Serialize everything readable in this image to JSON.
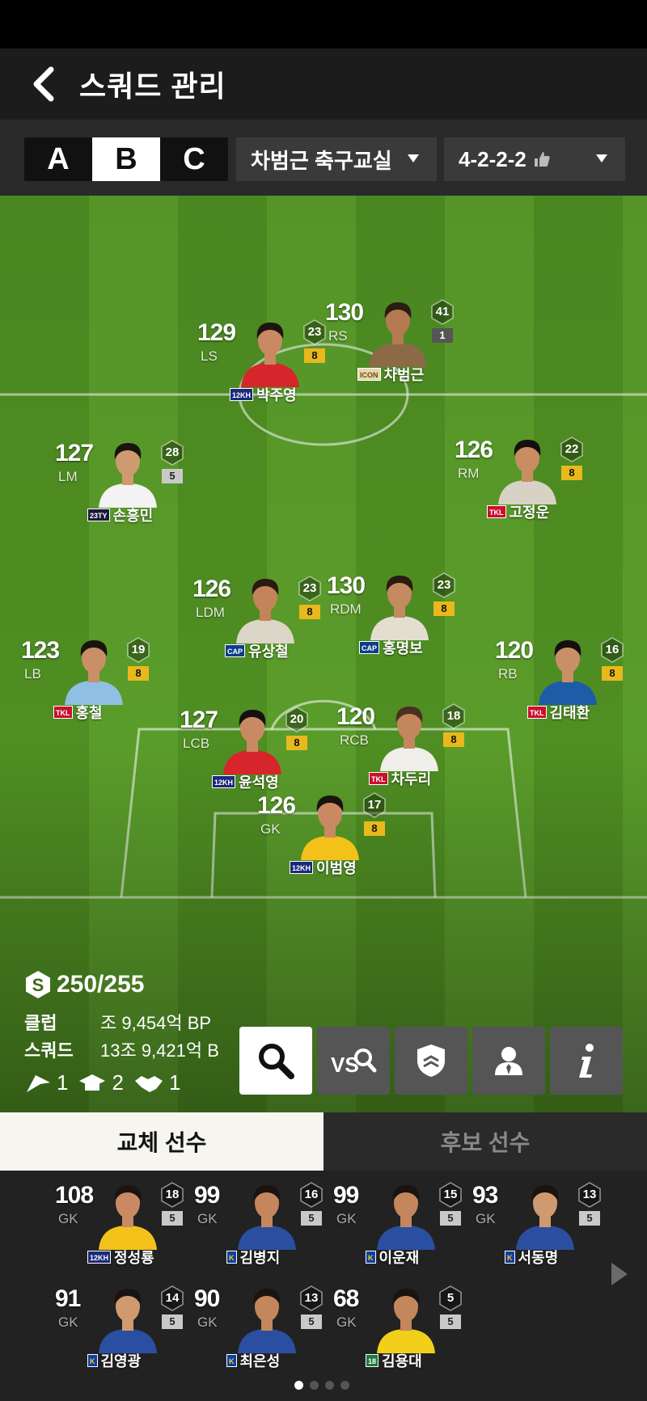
{
  "header": {
    "title": "스쿼드 관리"
  },
  "squad_tabs": [
    "A",
    "B",
    "C"
  ],
  "team_dropdown": {
    "value": "차범근 축구교실"
  },
  "formation_dropdown": {
    "value": "4-2-2-2"
  },
  "starters": [
    {
      "ovr": "129",
      "pos": "LS",
      "name": "박주영",
      "badge": "12KH",
      "badge_class": "b-12kh",
      "chem": "23",
      "level": "8",
      "level_style": "gold",
      "shirt": "#d7262b",
      "skin": "#c98a63",
      "hair": "#1c140f"
    },
    {
      "ovr": "130",
      "pos": "RS",
      "name": "차범근",
      "badge": "ICON",
      "badge_class": "b-icon",
      "chem": "41",
      "level": "1",
      "level_style": "gray",
      "shirt": "#8c6a45",
      "skin": "#b37a52",
      "hair": "#2a1c12"
    },
    {
      "ovr": "127",
      "pos": "LM",
      "name": "손흥민",
      "badge": "23TY",
      "badge_class": "b-23ty",
      "chem": "28",
      "level": "5",
      "level_style": "silver",
      "shirt": "#f3f3f3",
      "skin": "#d09a70",
      "hair": "#1a1410"
    },
    {
      "ovr": "126",
      "pos": "RM",
      "name": "고정운",
      "badge": "TKL",
      "badge_class": "b-tkl",
      "chem": "22",
      "level": "8",
      "level_style": "gold",
      "shirt": "#d8d2c4",
      "skin": "#c88d63",
      "hair": "#141010"
    },
    {
      "ovr": "126",
      "pos": "LDM",
      "name": "유상철",
      "badge": "CAP",
      "badge_class": "b-cap",
      "chem": "23",
      "level": "8",
      "level_style": "gold",
      "shirt": "#dcd6c8",
      "skin": "#c28458",
      "hair": "#2a1b10"
    },
    {
      "ovr": "130",
      "pos": "RDM",
      "name": "홍명보",
      "badge": "CAP",
      "badge_class": "b-cap",
      "chem": "23",
      "level": "8",
      "level_style": "gold",
      "shirt": "#e4ded0",
      "skin": "#c48a60",
      "hair": "#2a1a10"
    },
    {
      "ovr": "123",
      "pos": "LB",
      "name": "홍철",
      "badge": "TKL",
      "badge_class": "b-tkl",
      "chem": "19",
      "level": "8",
      "level_style": "gold",
      "shirt": "#8fc0e4",
      "skin": "#c98f66",
      "hair": "#1a1410"
    },
    {
      "ovr": "120",
      "pos": "RB",
      "name": "김태환",
      "badge": "TKL",
      "badge_class": "b-tkl",
      "chem": "16",
      "level": "8",
      "level_style": "gold",
      "shirt": "#1e5ca8",
      "skin": "#c98f66",
      "hair": "#141010"
    },
    {
      "ovr": "127",
      "pos": "LCB",
      "name": "윤석영",
      "badge": "12KH",
      "badge_class": "b-12kh",
      "chem": "20",
      "level": "8",
      "level_style": "gold",
      "shirt": "#d7262b",
      "skin": "#c98a63",
      "hair": "#161010"
    },
    {
      "ovr": "120",
      "pos": "RCB",
      "name": "차두리",
      "badge": "TKL",
      "badge_class": "b-tkl",
      "chem": "18",
      "level": "8",
      "level_style": "gold",
      "shirt": "#efeee8",
      "skin": "#c4865c",
      "hair": "#4a3020"
    },
    {
      "ovr": "126",
      "pos": "GK",
      "name": "이범영",
      "badge": "12KH",
      "badge_class": "b-12kh",
      "chem": "17",
      "level": "8",
      "level_style": "gold",
      "shirt": "#f2c21a",
      "skin": "#c98a63",
      "hair": "#1a1410"
    }
  ],
  "stats": {
    "salary": "250/255",
    "club_label": "클럽",
    "club_value": "조 9,454억 BP",
    "squad_label": "스쿼드",
    "squad_value": "13조 9,421억 B",
    "chem_flag": "1",
    "chem_grad": "2",
    "chem_hand": "1"
  },
  "tool_buttons": [
    "search-icon",
    "versus-search-icon",
    "shield-icon",
    "manager-icon",
    "info-icon"
  ],
  "bench_tabs": {
    "subs": "교체 선수",
    "reserves": "후보 선수"
  },
  "bench": [
    {
      "ovr": "108",
      "pos": "GK",
      "name": "정성룡",
      "badge": "12KH",
      "badge_class": "b-12kh",
      "chem": "18",
      "level": "5",
      "level_style": "silver",
      "shirt": "#f2c21a",
      "skin": "#c98a63",
      "hair": "#1a1410"
    },
    {
      "ovr": "99",
      "pos": "GK",
      "name": "김병지",
      "badge": "K",
      "badge_class": "b-k",
      "chem": "16",
      "level": "5",
      "level_style": "silver",
      "shirt": "#2b4fa0",
      "skin": "#c4865c",
      "hair": "#1a1410"
    },
    {
      "ovr": "99",
      "pos": "GK",
      "name": "이운재",
      "badge": "K",
      "badge_class": "b-k",
      "chem": "15",
      "level": "5",
      "level_style": "silver",
      "shirt": "#2b4fa0",
      "skin": "#c4865c",
      "hair": "#1a1410"
    },
    {
      "ovr": "93",
      "pos": "GK",
      "name": "서동명",
      "badge": "K",
      "badge_class": "b-k",
      "chem": "13",
      "level": "5",
      "level_style": "silver",
      "shirt": "#2b4fa0",
      "skin": "#d09a70",
      "hair": "#1a1410"
    },
    {
      "ovr": "91",
      "pos": "GK",
      "name": "김영광",
      "badge": "K",
      "badge_class": "b-k",
      "chem": "14",
      "level": "5",
      "level_style": "silver",
      "shirt": "#2b4fa0",
      "skin": "#d09a70",
      "hair": "#1a1410"
    },
    {
      "ovr": "90",
      "pos": "GK",
      "name": "최은성",
      "badge": "K",
      "badge_class": "b-k",
      "chem": "13",
      "level": "5",
      "level_style": "silver",
      "shirt": "#2b4fa0",
      "skin": "#c4865c",
      "hair": "#1a1410"
    },
    {
      "ovr": "68",
      "pos": "GK",
      "name": "김용대",
      "badge": "18",
      "badge_class": "b-18",
      "chem": "5",
      "level": "5",
      "level_style": "silver",
      "shirt": "#f2d01a",
      "skin": "#c4865c",
      "hair": "#1a1410"
    }
  ],
  "pager": {
    "total": 4,
    "active": 0
  }
}
